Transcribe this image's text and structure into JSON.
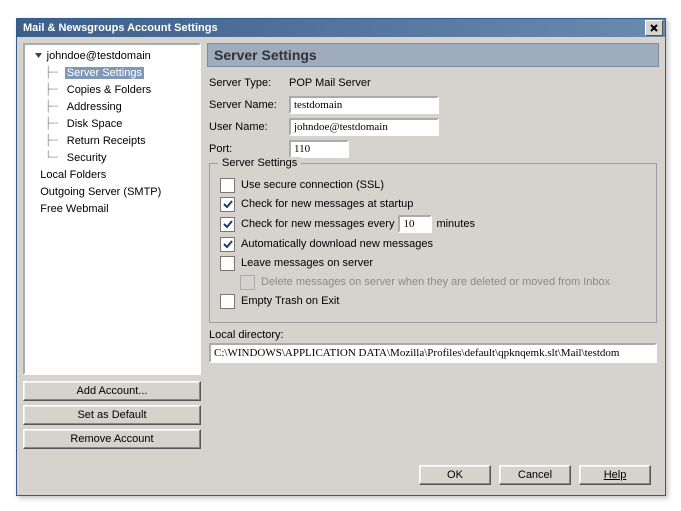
{
  "title": "Mail & Newsgroups Account Settings",
  "tree": {
    "account": "johndoe@testdomain",
    "children": [
      "Server Settings",
      "Copies & Folders",
      "Addressing",
      "Disk Space",
      "Return Receipts",
      "Security"
    ],
    "selected_index": 0,
    "roots": [
      "Local Folders",
      "Outgoing Server (SMTP)",
      "Free Webmail"
    ]
  },
  "tree_buttons": {
    "add": "Add Account...",
    "default": "Set as Default",
    "remove": "Remove Account"
  },
  "header": "Server Settings",
  "server_type_label": "Server Type:",
  "server_type_value": "POP Mail Server",
  "server_name_label": "Server Name:",
  "server_name_value": "testdomain",
  "user_name_label": "User Name:",
  "user_name_value": "johndoe@testdomain",
  "port_label": "Port:",
  "port_value": "110",
  "fieldset_legend": "Server Settings",
  "opts": {
    "ssl": {
      "label": "Use secure connection (SSL)",
      "checked": false
    },
    "startup": {
      "label": "Check for new messages at startup",
      "checked": true
    },
    "every": {
      "prefix": "Check for new messages every",
      "value": "10",
      "suffix": "minutes",
      "checked": true
    },
    "auto": {
      "label": "Automatically download new messages",
      "checked": true
    },
    "leave": {
      "label": "Leave messages on server",
      "checked": false
    },
    "delete_moved": {
      "label": "Delete messages on server when they are deleted or moved from Inbox",
      "checked": false,
      "disabled": true
    },
    "empty_trash": {
      "label": "Empty Trash on Exit",
      "checked": false
    }
  },
  "local_dir_label": "Local directory:",
  "local_dir_value": "C:\\WINDOWS\\APPLICATION DATA\\Mozilla\\Profiles\\default\\qpknqemk.slt\\Mail\\testdom",
  "footer": {
    "ok": "OK",
    "cancel": "Cancel",
    "help": "Help"
  }
}
